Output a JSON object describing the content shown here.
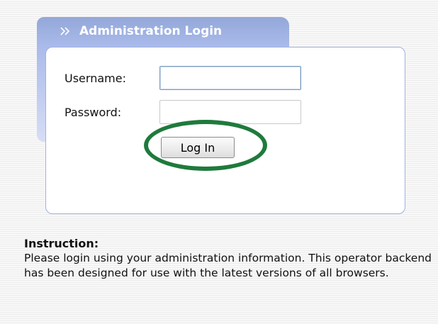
{
  "login_panel": {
    "title": "Administration Login",
    "icon": "double-chevron-right-icon",
    "accent_color": "#a9baea",
    "username_label": "Username:",
    "username_value": "",
    "password_label": "Password:",
    "password_value": "",
    "login_button_label": "Log In",
    "highlight_color": "#1f7a3c"
  },
  "instruction": {
    "title": "Instruction:",
    "text": "Please login using your administration information. This operator backend has been designed for use with the latest versions of all browsers."
  }
}
